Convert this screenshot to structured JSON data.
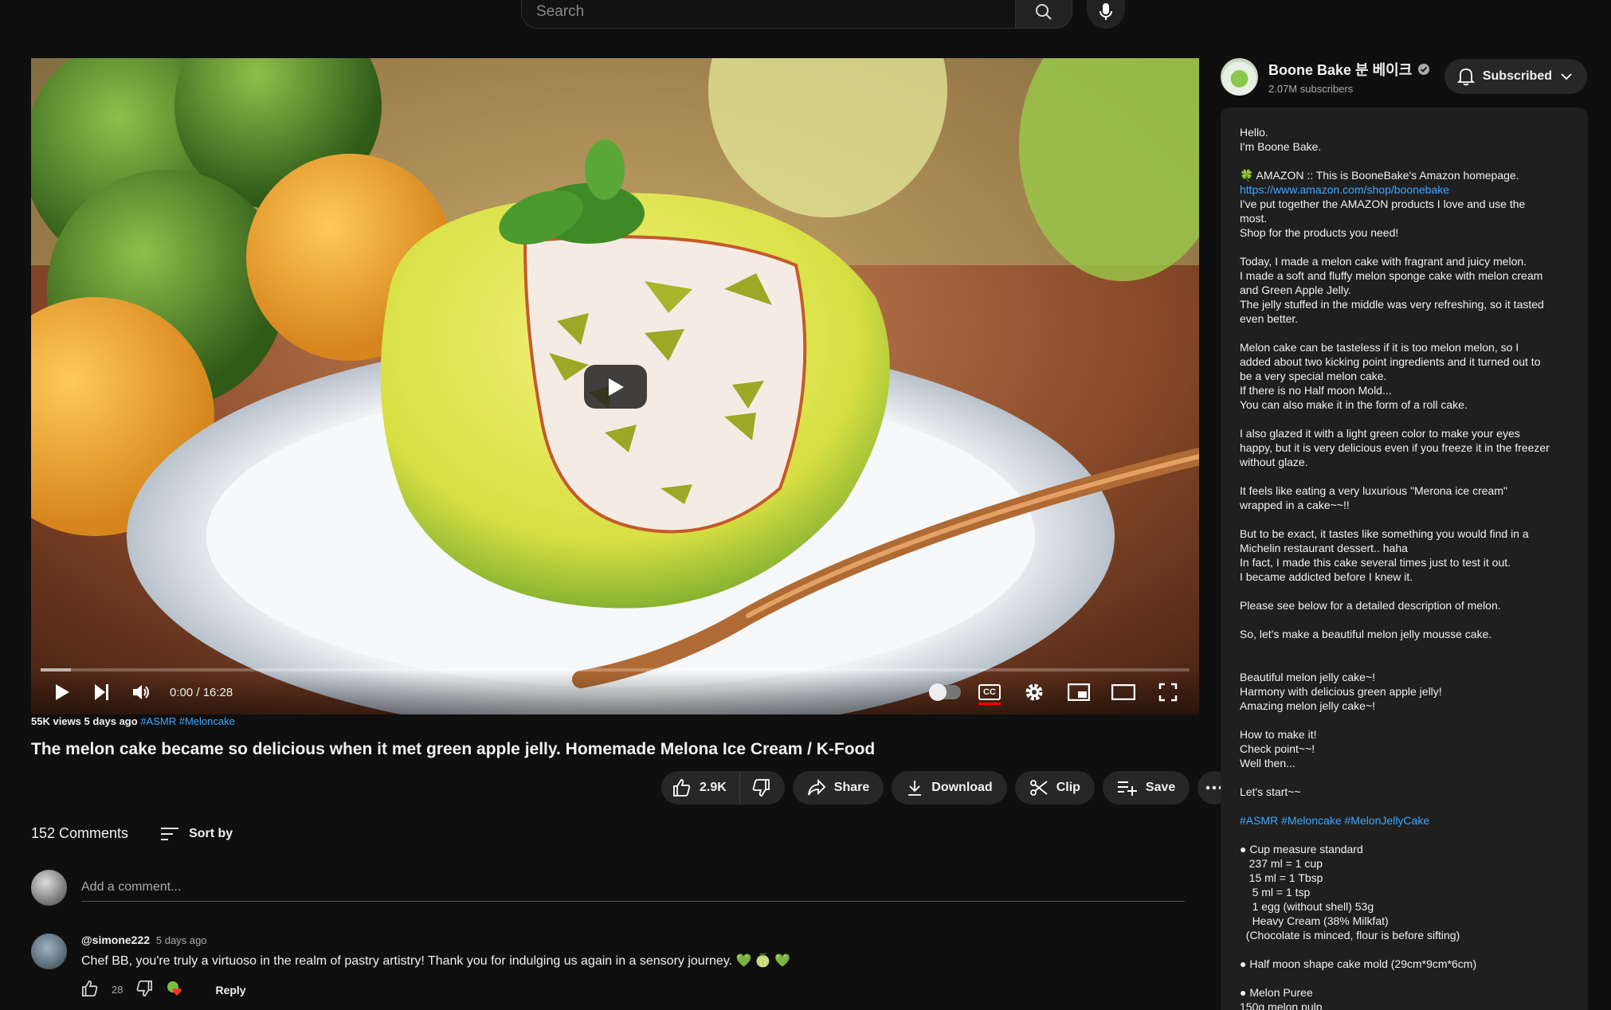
{
  "search": {
    "placeholder": "Search"
  },
  "player": {
    "time": "0:00 / 16:28",
    "cc_label": "CC"
  },
  "video": {
    "meta": "55K views  5 days ago",
    "tags": "#ASMR #Meloncake",
    "title": "The melon cake became so delicious when it met green apple jelly. Homemade Melona Ice Cream / K-Food"
  },
  "actions": {
    "likes": "2.9K",
    "share": "Share",
    "download": "Download",
    "clip": "Clip",
    "save": "Save"
  },
  "comments": {
    "count": "152 Comments",
    "sort_label": "Sort by",
    "add_placeholder": "Add a comment...",
    "items": [
      {
        "author": "@simone222",
        "time": "5 days ago",
        "text": "Chef BB, you're truly a virtuoso in the realm of pastry artistry! Thank you for indulging us again in a sensory journey. 💚 🍈 💚",
        "likes": "28",
        "reply": "Reply"
      }
    ]
  },
  "channel": {
    "name": "Boone Bake 분 베이크",
    "subscribers": "2.07M subscribers",
    "subscribe_label": "Subscribed"
  },
  "description": [
    "Hello.",
    "I'm Boone Bake.",
    "",
    "🍀 AMAZON :: This is BooneBake's Amazon homepage.",
    "https://www.amazon.com/shop/boonebake",
    "I've put together the AMAZON products I love and use the",
    "most.",
    "Shop for the products you need!",
    "",
    "Today, I made a melon cake with fragrant and juicy melon.",
    "I made a soft and fluffy melon sponge cake with melon cream",
    "and Green Apple Jelly.",
    "The jelly stuffed in the middle was very refreshing, so it tasted",
    "even better.",
    "",
    "Melon cake can be tasteless if it is too melon melon, so I",
    "added about two kicking point ingredients and it turned out to",
    "be a very special melon cake.",
    "If there is no Half moon Mold...",
    "You can also make it in the form of a roll cake.",
    "",
    "I also glazed it with a light green color to make your eyes",
    "happy, but it is very delicious even if you freeze it in the freezer",
    "without glaze.",
    "",
    "It feels like eating a very luxurious \"Merona ice cream\"",
    "wrapped in a cake~~!!",
    "",
    "But to be exact, it tastes like something you would find in a",
    "Michelin restaurant dessert.. haha",
    "In fact, I made this cake several times just to test it out.",
    "I became addicted before I knew it.",
    "",
    "Please see below for a detailed description of melon.",
    "",
    "So, let's make a beautiful melon jelly mousse cake.",
    "",
    "",
    "Beautiful melon jelly cake~!",
    "Harmony with delicious green apple jelly!",
    "Amazing melon jelly cake~!",
    "",
    "How to make it!",
    "Check point~~!",
    "Well then...",
    "",
    "Let's start~~",
    "",
    "#ASMR #Meloncake #MelonJellyCake",
    "",
    "● Cup measure standard",
    "   237 ml = 1 cup",
    "   15 ml = 1 Tbsp",
    "    5 ml = 1 tsp",
    "    1 egg (without shell) 53g",
    "    Heavy Cream (38% Milkfat)",
    "  (Chocolate is minced, flour is before sifting)",
    "",
    "● Half moon shape cake mold (29cm*9cm*6cm)",
    "",
    "● Melon Puree",
    "150g melon pulp"
  ]
}
